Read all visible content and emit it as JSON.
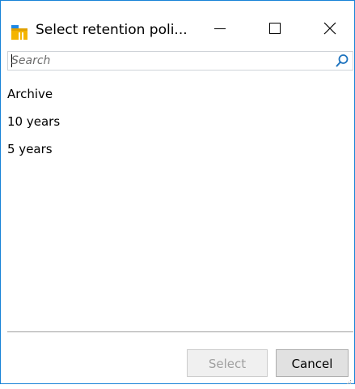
{
  "window": {
    "title": "Select retention poli...",
    "app_icon": "retention-policy-icon",
    "border_color": "#1883d7"
  },
  "caption_buttons": {
    "minimize_icon": "minimize-icon",
    "maximize_icon": "maximize-icon",
    "close_icon": "close-icon"
  },
  "search": {
    "placeholder": "Search",
    "value": "",
    "icon": "search-icon"
  },
  "list": {
    "items": [
      {
        "label": "Archive"
      },
      {
        "label": "10 years"
      },
      {
        "label": "5 years"
      }
    ]
  },
  "footer": {
    "select_label": "Select",
    "select_enabled": false,
    "cancel_label": "Cancel"
  }
}
